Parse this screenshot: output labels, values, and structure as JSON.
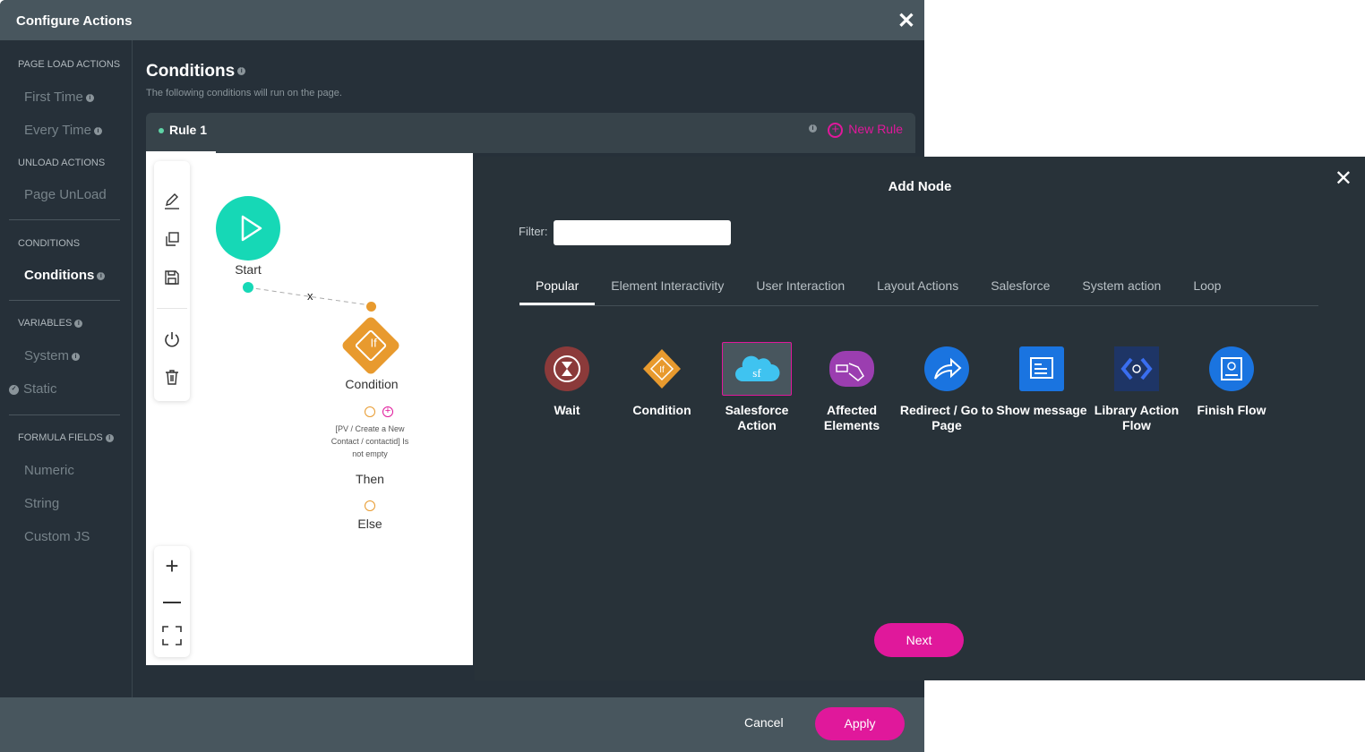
{
  "modal": {
    "title": "Configure Actions",
    "close_icon": "close-icon"
  },
  "sidebar": {
    "sections": [
      {
        "label": "PAGE LOAD ACTIONS"
      },
      {
        "label": "UNLOAD ACTIONS"
      },
      {
        "label": "CONDITIONS"
      },
      {
        "label": "VARIABLES"
      },
      {
        "label": "FORMULA FIELDS"
      }
    ],
    "items": {
      "first_time": "First Time",
      "every_time": "Every Time",
      "page_unload": "Page UnLoad",
      "conditions": "Conditions",
      "system": "System",
      "static": "Static",
      "numeric": "Numeric",
      "string": "String",
      "custom_js": "Custom JS"
    }
  },
  "main": {
    "title": "Conditions",
    "subtitle": "The following conditions will run on the page.",
    "rule_tab": "Rule 1",
    "new_rule": "New Rule"
  },
  "flow": {
    "start": "Start",
    "edge_label": "x",
    "condition": "Condition",
    "condition_icon_text": "If",
    "condition_text": "[PV / Create a New Contact / contactid] Is not empty",
    "then": "Then",
    "else": "Else"
  },
  "footer": {
    "cancel": "Cancel",
    "apply": "Apply"
  },
  "add_node": {
    "title": "Add Node",
    "filter_label": "Filter:",
    "filter_value": "",
    "tabs": [
      "Popular",
      "Element Interactivity",
      "User Interaction",
      "Layout Actions",
      "Salesforce",
      "System action",
      "Loop"
    ],
    "active_tab": "Popular",
    "nodes": [
      {
        "label": "Wait",
        "icon": "hourglass-icon",
        "color": "#8b3a3a"
      },
      {
        "label": "Condition",
        "icon": "if-diamond-icon",
        "color": "#e89a2e"
      },
      {
        "label": "Salesforce Action",
        "icon": "salesforce-cloud-icon",
        "color": "#3fc3f0",
        "selected": true
      },
      {
        "label": "Affected Elements",
        "icon": "hand-pointer-icon",
        "color": "#9b3eb0"
      },
      {
        "label": "Redirect / Go to Page",
        "icon": "share-arrow-icon",
        "color": "#1a74e0"
      },
      {
        "label": "Show message",
        "icon": "message-icon",
        "color": "#1a74e0"
      },
      {
        "label": "Library Action Flow",
        "icon": "code-library-icon",
        "color": "#1e3566"
      },
      {
        "label": "Finish Flow",
        "icon": "finish-icon",
        "color": "#1a74e0"
      }
    ],
    "next": "Next"
  },
  "colors": {
    "accent": "#e0189b",
    "start": "#16d8b6",
    "condition": "#e89a2e"
  }
}
